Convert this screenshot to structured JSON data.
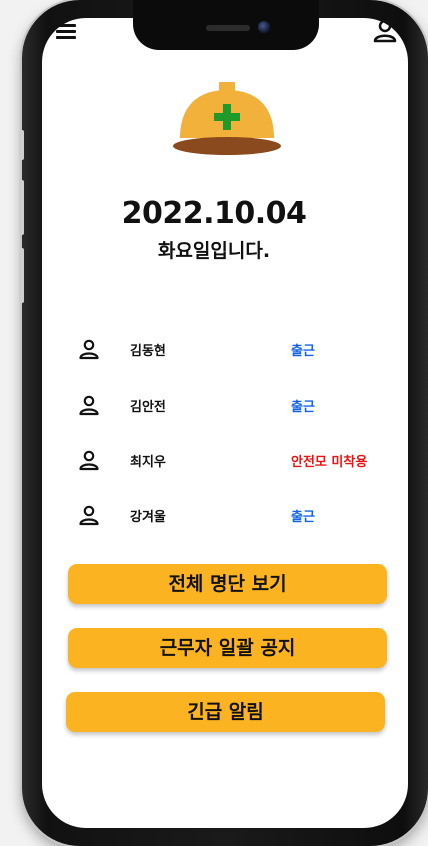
{
  "header": {
    "menu_icon": "hamburger-menu-icon",
    "profile_icon": "user-icon"
  },
  "hero": {
    "logo_icon": "hard-hat-icon",
    "date": "2022.10.04",
    "weekday_text": "화요일입니다."
  },
  "workers": [
    {
      "name": "김동현",
      "status": "출근",
      "status_color": "#1565e8"
    },
    {
      "name": "김안전",
      "status": "출근",
      "status_color": "#1565e8"
    },
    {
      "name": "최지우",
      "status": "안전모 미착용",
      "status_color": "#e81414"
    },
    {
      "name": "강겨울",
      "status": "출근",
      "status_color": "#1565e8"
    }
  ],
  "actions": {
    "view_all_label": "전체 명단 보기",
    "notice_all_label": "근무자 일괄 공지",
    "emergency_label": "긴급 알림"
  },
  "colors": {
    "accent": "#fbb321",
    "helmet_yellow": "#f2b13a",
    "helmet_brim": "#8a4a1e",
    "cross_green": "#1f9a2b"
  }
}
